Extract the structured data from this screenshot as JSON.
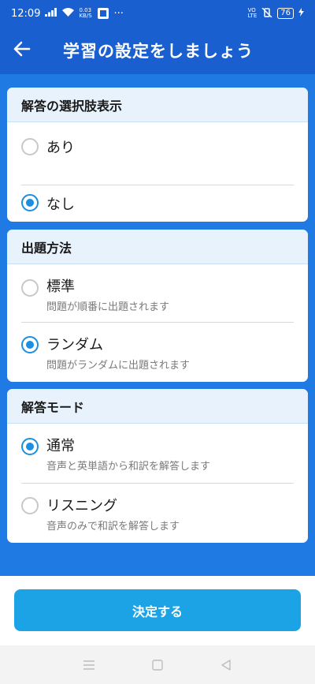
{
  "status_bar": {
    "time": "12:09",
    "network_speed": "0.03\nKB/S",
    "dots": "···",
    "volte": "VO\nLTE",
    "battery": "76"
  },
  "app_bar": {
    "title": "学習の設定をしましょう",
    "back_icon": "arrow-left-icon"
  },
  "sections": [
    {
      "header": "解答の選択肢表示",
      "options": [
        {
          "label": "あり",
          "checked": false
        },
        {
          "label": "なし",
          "checked": true
        }
      ]
    },
    {
      "header": "出題方法",
      "options": [
        {
          "label": "標準",
          "sub": "問題が順番に出題されます",
          "checked": false
        },
        {
          "label": "ランダム",
          "sub": "問題がランダムに出題されます",
          "checked": true
        }
      ]
    },
    {
      "header": "解答モード",
      "options": [
        {
          "label": "通常",
          "sub": "音声と英単語から和訳を解答します",
          "checked": true
        },
        {
          "label": "リスニング",
          "sub": "音声のみで和訳を解答します",
          "checked": false
        }
      ]
    }
  ],
  "footer": {
    "decide_label": "決定する"
  },
  "nav_bar": {
    "icons": [
      "menu-icon",
      "home-square-icon",
      "back-triangle-icon"
    ]
  },
  "colors": {
    "app_bar": "#1a5fd0",
    "background": "#1f7be3",
    "accent": "#1b8fe0",
    "button": "#1ba3e6"
  }
}
